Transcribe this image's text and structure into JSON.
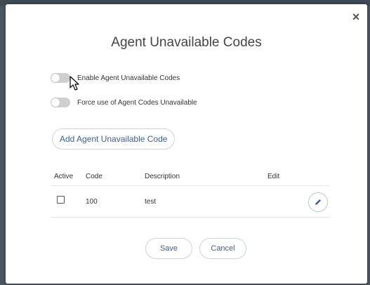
{
  "modal": {
    "title": "Agent Unavailable Codes",
    "close_glyph": "×"
  },
  "toggles": [
    {
      "label": "Enable Agent Unavailable Codes",
      "on": false
    },
    {
      "label": "Force use of Agent Codes Unavailable",
      "on": false
    }
  ],
  "add_button_label": "Add Agent Unavailable Code",
  "table": {
    "headers": {
      "active": "Active",
      "code": "Code",
      "description": "Description",
      "edit": "Edit"
    },
    "rows": [
      {
        "active": false,
        "code": "100",
        "description": "test"
      }
    ]
  },
  "footer": {
    "save_label": "Save",
    "cancel_label": "Cancel"
  },
  "colors": {
    "accent": "#3c5f8e",
    "toggle_off": "#cfcfcf",
    "backdrop": "#4a5561"
  },
  "icons": {
    "close": "close-icon",
    "edit": "pencil-icon",
    "cursor": "mouse-pointer-icon"
  }
}
